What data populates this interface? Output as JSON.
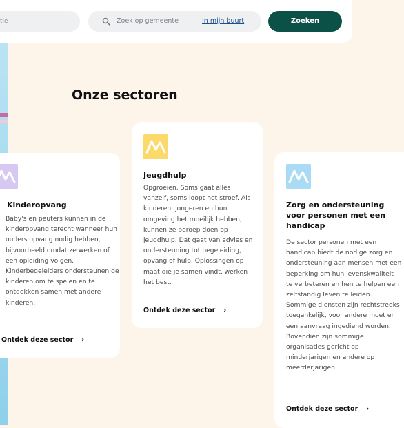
{
  "search": {
    "left_field_fragment": "tie",
    "placeholder": "Zoek op gemeente",
    "nearby_link": "In mijn buurt",
    "submit_label": "Zoeken",
    "icon": "search-icon"
  },
  "section_title": "Onze sectoren",
  "cards": [
    {
      "id": "kinderopvang",
      "title": "Kinderopvang",
      "description": "Baby's en peuters kunnen in de kinderopvang terecht wanneer hun ouders opvang nodig hebben, bijvoorbeeld omdat ze werken of een opleiding volgen. Kinderbegeleiders ondersteunen de kinderen om te spelen en te ontdekken samen met andere kinderen.",
      "cta": "Ontdek deze sector",
      "logo_color": "#d7c7f3"
    },
    {
      "id": "jeugdhulp",
      "title": "Jeugdhulp",
      "description": "Opgroeien. Soms gaat alles vanzelf, soms loopt het stroef. Als kinderen, jongeren en hun omgeving het moeilijk hebben, kunnen ze beroep doen op jeugdhulp. Dat gaat van advies en ondersteuning tot begeleiding, opvang of hulp. Oplossingen op maat die je samen vindt, werken het best.",
      "cta": "Ontdek deze sector",
      "logo_color": "#fbd96a"
    },
    {
      "id": "zorg",
      "title": "Zorg en ondersteuning voor personen met een handicap",
      "description": "De sector personen met een handicap biedt de nodige zorg en ondersteuning aan mensen met een beperking om hun levenskwaliteit te verbeteren en hen te helpen een zelfstandig leven te leiden. Sommige diensten zijn rechtstreeks toegankelijk, voor andere moet er een aanvraag ingediend worden. Bovendien zijn sommige organisaties gericht op minderjarigen en andere op meerderjarigen.",
      "cta": "Ontdek deze sector",
      "logo_color": "#a9dcf4"
    }
  ],
  "cta_icon": "chevron-right-icon",
  "colors": {
    "background": "#fdf5ea",
    "primary_button": "#0c5147",
    "link": "#1b4f8a"
  }
}
